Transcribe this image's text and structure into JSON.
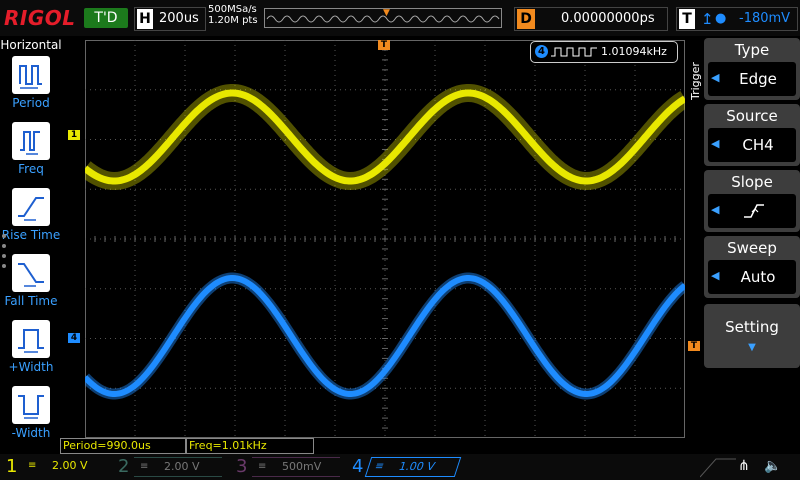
{
  "brand": "RIGOL",
  "run_status": "T'D",
  "horizontal": {
    "label": "H",
    "timebase": "200us",
    "sample_rate": "500MSa/s",
    "points": "1.20M pts"
  },
  "delay": {
    "label": "D",
    "value": "0.00000000ps"
  },
  "trigger_status": {
    "label": "T",
    "edge_icon": "rising-edge-icon",
    "channel_icon": "ch4-icon",
    "level": "-180mV"
  },
  "left_menu": {
    "title": "Horizontal",
    "items": [
      {
        "label": "Period",
        "icon": "period-icon"
      },
      {
        "label": "Freq",
        "icon": "freq-icon"
      },
      {
        "label": "Rise Time",
        "icon": "rise-time-icon"
      },
      {
        "label": "Fall Time",
        "icon": "fall-time-icon"
      },
      {
        "label": "+Width",
        "icon": "positive-width-icon"
      },
      {
        "label": "-Width",
        "icon": "negative-width-icon"
      }
    ]
  },
  "freq_counter": {
    "channel": "4",
    "value": "1.01094kHz"
  },
  "trigger_vertical": "Trigger",
  "right_menu": {
    "type": {
      "title": "Type",
      "value": "Edge"
    },
    "source": {
      "title": "Source",
      "value": "CH4"
    },
    "slope": {
      "title": "Slope",
      "icon": "rising-slope-icon"
    },
    "sweep": {
      "title": "Sweep",
      "value": "Auto"
    },
    "setting": {
      "title": "Setting"
    }
  },
  "measurements": {
    "period": "Period=990.0us",
    "freq": "Freq=1.01kHz"
  },
  "channels": [
    {
      "num": "1",
      "scale": "2.00 V",
      "color": "#e8e800",
      "active": true
    },
    {
      "num": "2",
      "scale": "2.00 V",
      "color": "#18c0a8",
      "active": false
    },
    {
      "num": "3",
      "scale": "500mV",
      "color": "#e030e0",
      "active": false
    },
    {
      "num": "4",
      "scale": "1.00 V",
      "color": "#1e8cff",
      "active": true
    }
  ],
  "markers": {
    "ch1": "1",
    "ch4": "4",
    "trigger": "T"
  },
  "colors": {
    "ch1": "#e8e800",
    "ch4": "#1e8cff",
    "trigger": "#f28a1e",
    "brand": "#e51d2a"
  }
}
